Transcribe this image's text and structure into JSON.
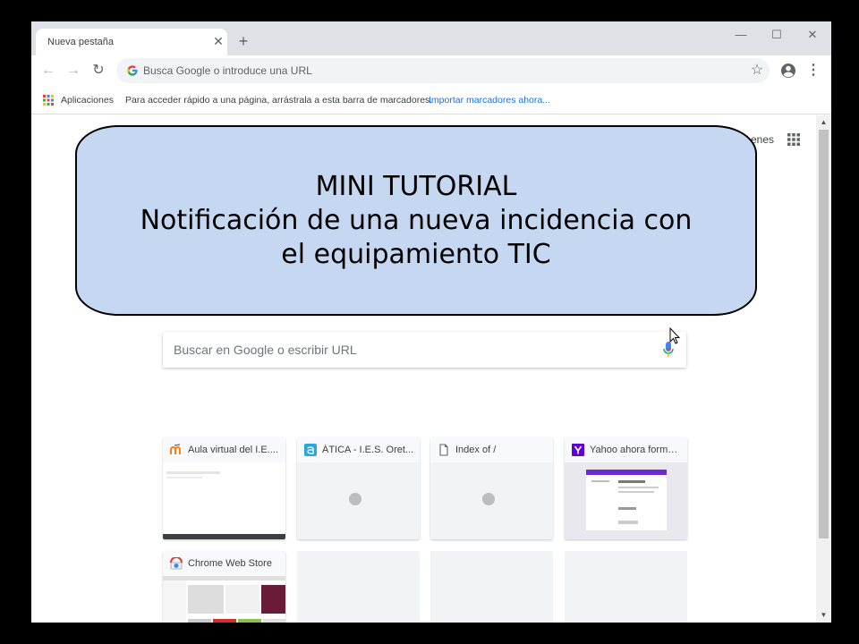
{
  "browser": {
    "tab": {
      "title": "Nueva pestaña",
      "close_glyph": "✕"
    },
    "newtab_glyph": "+",
    "window_controls": {
      "minimize": "—",
      "maximize": "☐",
      "close": "✕"
    },
    "nav": {
      "back_glyph": "←",
      "forward_glyph": "→",
      "reload_glyph": "↻"
    },
    "omnibox_placeholder": "Busca Google o introduce una URL",
    "star_glyph": "☆",
    "menu_glyph": "⋮"
  },
  "bookmarks_bar": {
    "apps_label": "Aplicaciones",
    "hint": "Para acceder rápido a una página, arrástrala a esta barra de marcadores.",
    "import_link": "Importar marcadores ahora..."
  },
  "ntp": {
    "top_right_partial_text": "enes",
    "search_placeholder": "Buscar en Google o escribir URL",
    "tiles": [
      {
        "title": "Aula virtual del I.E....",
        "favicon": "moodle-icon",
        "accent": "#f98012"
      },
      {
        "title": "ÁTICA - I.E.S. Oret...",
        "favicon": "atica-icon",
        "accent": "#29a8e0"
      },
      {
        "title": "Index of /",
        "favicon": "page-icon",
        "accent": "#5f6368"
      },
      {
        "title": "Yahoo ahora forma ...",
        "favicon": "yahoo-icon",
        "accent": "#5f01d1"
      },
      {
        "title": "Chrome Web Store",
        "favicon": "chrome-webstore-icon",
        "accent": "#e53935"
      }
    ]
  },
  "overlay": {
    "lines": [
      "MINI TUTORIAL",
      "Notificación de una nueva incidencia con",
      "el equipamiento TIC"
    ]
  },
  "scrollbar": {
    "up_glyph": "▲",
    "down_glyph": "▼"
  },
  "colors": {
    "overlay_fill": "#c6d8f1",
    "link": "#1a73e8",
    "tabstrip": "#dee1e6"
  }
}
